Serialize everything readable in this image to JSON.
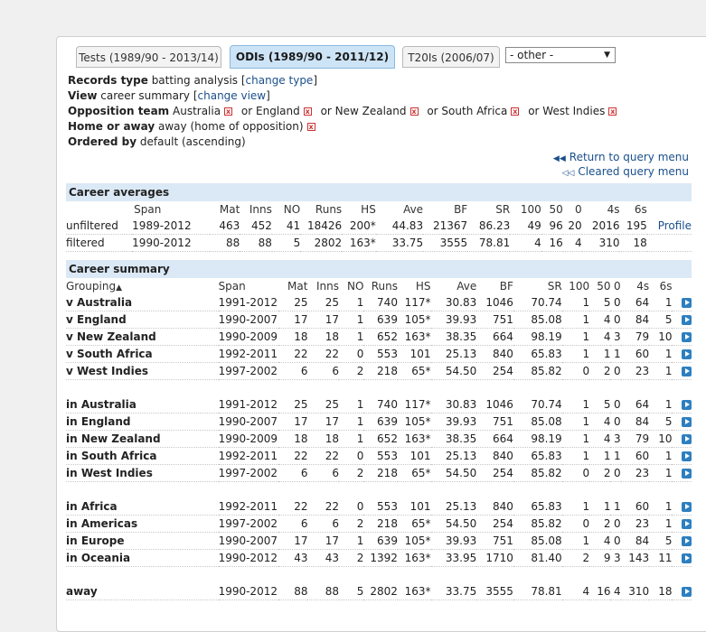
{
  "tabs": [
    {
      "label": "Tests (1989/90 - 2013/14)",
      "active": false
    },
    {
      "label": "ODIs (1989/90 - 2011/12)",
      "active": true
    },
    {
      "label": "T20Is (2006/07)",
      "active": false
    }
  ],
  "select": {
    "value": "- other -"
  },
  "query": {
    "records_type_label": "Records type",
    "records_type_value": "batting analysis",
    "change_type": "change type",
    "view_label": "View",
    "view_value": "career summary",
    "change_view": "change view",
    "opposition_label": "Opposition team",
    "opposition_teams": [
      "Australia",
      "or England",
      "or New Zealand",
      "or South Africa",
      "or West Indies"
    ],
    "home_away_label": "Home or away",
    "home_away_value": "away (home of opposition)",
    "ordered_label": "Ordered by",
    "ordered_value": "default (ascending)"
  },
  "links": {
    "return": "Return to query menu",
    "cleared": "Cleared query menu"
  },
  "career_averages": {
    "title": "Career averages",
    "headers": [
      "",
      "Span",
      "Mat",
      "Inns",
      "NO",
      "Runs",
      "HS",
      "Ave",
      "BF",
      "SR",
      "100",
      "50",
      "0",
      "4s",
      "6s",
      ""
    ],
    "rows": [
      [
        "unfiltered",
        "1989-2012",
        "463",
        "452",
        "41",
        "18426",
        "200*",
        "44.83",
        "21367",
        "86.23",
        "49",
        "96",
        "20",
        "2016",
        "195",
        "Profile"
      ],
      [
        "filtered",
        "1990-2012",
        "88",
        "88",
        "5",
        "2802",
        "163*",
        "33.75",
        "3555",
        "78.81",
        "4",
        "16",
        "4",
        "310",
        "18",
        ""
      ]
    ]
  },
  "career_summary": {
    "title": "Career summary",
    "headers": [
      "Grouping",
      "Span",
      "Mat",
      "Inns",
      "NO",
      "Runs",
      "HS",
      "Ave",
      "BF",
      "SR",
      "100",
      "50",
      "0",
      "4s",
      "6s"
    ],
    "sort_indicator": "▲",
    "groups": [
      [
        [
          "v Australia",
          "1991-2012",
          "25",
          "25",
          "1",
          "740",
          "117*",
          "30.83",
          "1046",
          "70.74",
          "1",
          "5",
          "0",
          "64",
          "1"
        ],
        [
          "v England",
          "1990-2007",
          "17",
          "17",
          "1",
          "639",
          "105*",
          "39.93",
          "751",
          "85.08",
          "1",
          "4",
          "0",
          "84",
          "5"
        ],
        [
          "v New Zealand",
          "1990-2009",
          "18",
          "18",
          "1",
          "652",
          "163*",
          "38.35",
          "664",
          "98.19",
          "1",
          "4",
          "3",
          "79",
          "10"
        ],
        [
          "v South Africa",
          "1992-2011",
          "22",
          "22",
          "0",
          "553",
          "101",
          "25.13",
          "840",
          "65.83",
          "1",
          "1",
          "1",
          "60",
          "1"
        ],
        [
          "v West Indies",
          "1997-2002",
          "6",
          "6",
          "2",
          "218",
          "65*",
          "54.50",
          "254",
          "85.82",
          "0",
          "2",
          "0",
          "23",
          "1"
        ]
      ],
      [
        [
          "in Australia",
          "1991-2012",
          "25",
          "25",
          "1",
          "740",
          "117*",
          "30.83",
          "1046",
          "70.74",
          "1",
          "5",
          "0",
          "64",
          "1"
        ],
        [
          "in England",
          "1990-2007",
          "17",
          "17",
          "1",
          "639",
          "105*",
          "39.93",
          "751",
          "85.08",
          "1",
          "4",
          "0",
          "84",
          "5"
        ],
        [
          "in New Zealand",
          "1990-2009",
          "18",
          "18",
          "1",
          "652",
          "163*",
          "38.35",
          "664",
          "98.19",
          "1",
          "4",
          "3",
          "79",
          "10"
        ],
        [
          "in South Africa",
          "1992-2011",
          "22",
          "22",
          "0",
          "553",
          "101",
          "25.13",
          "840",
          "65.83",
          "1",
          "1",
          "1",
          "60",
          "1"
        ],
        [
          "in West Indies",
          "1997-2002",
          "6",
          "6",
          "2",
          "218",
          "65*",
          "54.50",
          "254",
          "85.82",
          "0",
          "2",
          "0",
          "23",
          "1"
        ]
      ],
      [
        [
          "in Africa",
          "1992-2011",
          "22",
          "22",
          "0",
          "553",
          "101",
          "25.13",
          "840",
          "65.83",
          "1",
          "1",
          "1",
          "60",
          "1"
        ],
        [
          "in Americas",
          "1997-2002",
          "6",
          "6",
          "2",
          "218",
          "65*",
          "54.50",
          "254",
          "85.82",
          "0",
          "2",
          "0",
          "23",
          "1"
        ],
        [
          "in Europe",
          "1990-2007",
          "17",
          "17",
          "1",
          "639",
          "105*",
          "39.93",
          "751",
          "85.08",
          "1",
          "4",
          "0",
          "84",
          "5"
        ],
        [
          "in Oceania",
          "1990-2012",
          "43",
          "43",
          "2",
          "1392",
          "163*",
          "33.95",
          "1710",
          "81.40",
          "2",
          "9",
          "3",
          "143",
          "11"
        ]
      ],
      [
        [
          "away",
          "1990-2012",
          "88",
          "88",
          "5",
          "2802",
          "163*",
          "33.75",
          "3555",
          "78.81",
          "4",
          "16",
          "4",
          "310",
          "18"
        ]
      ]
    ]
  },
  "colors": {
    "accent": "#2d7fc0",
    "section_bg": "#dbe9f6",
    "tab_active": "#cde4f7",
    "link": "#1a4f8b"
  }
}
